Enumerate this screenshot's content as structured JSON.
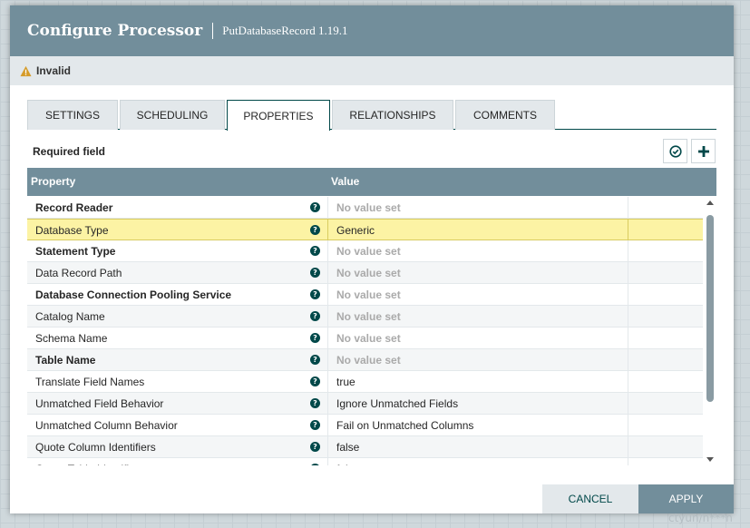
{
  "dialog": {
    "title": "Configure Processor",
    "subtitle": "PutDatabaseRecord 1.19.1",
    "status": "Invalid"
  },
  "tabs": [
    {
      "label": "SETTINGS"
    },
    {
      "label": "SCHEDULING"
    },
    {
      "label": "PROPERTIES",
      "active": true
    },
    {
      "label": "RELATIONSHIPS"
    },
    {
      "label": "COMMENTS"
    }
  ],
  "properties": {
    "required_label": "Required field",
    "header_property": "Property",
    "header_value": "Value",
    "rows": [
      {
        "name": "Record Reader",
        "value": "No value set",
        "required": true,
        "unset": true
      },
      {
        "name": "Database Type",
        "value": "Generic",
        "required": false,
        "unset": false,
        "selected": true
      },
      {
        "name": "Statement Type",
        "value": "No value set",
        "required": true,
        "unset": true
      },
      {
        "name": "Data Record Path",
        "value": "No value set",
        "required": false,
        "unset": true
      },
      {
        "name": "Database Connection Pooling Service",
        "value": "No value set",
        "required": true,
        "unset": true
      },
      {
        "name": "Catalog Name",
        "value": "No value set",
        "required": false,
        "unset": true
      },
      {
        "name": "Schema Name",
        "value": "No value set",
        "required": false,
        "unset": true
      },
      {
        "name": "Table Name",
        "value": "No value set",
        "required": true,
        "unset": true
      },
      {
        "name": "Translate Field Names",
        "value": "true",
        "required": false,
        "unset": false
      },
      {
        "name": "Unmatched Field Behavior",
        "value": "Ignore Unmatched Fields",
        "required": false,
        "unset": false
      },
      {
        "name": "Unmatched Column Behavior",
        "value": "Fail on Unmatched Columns",
        "required": false,
        "unset": false
      },
      {
        "name": "Quote Column Identifiers",
        "value": "false",
        "required": false,
        "unset": false
      },
      {
        "name": "Quote Table Identifiers",
        "value": "false",
        "required": false,
        "unset": false
      }
    ]
  },
  "buttons": {
    "cancel": "CANCEL",
    "apply": "APPLY"
  },
  "watermark": "ctyun/n***n",
  "colors": {
    "header": "#728e9b",
    "accent": "#004849",
    "selected_row": "#fcf3a4",
    "warning": "#d59b29"
  }
}
